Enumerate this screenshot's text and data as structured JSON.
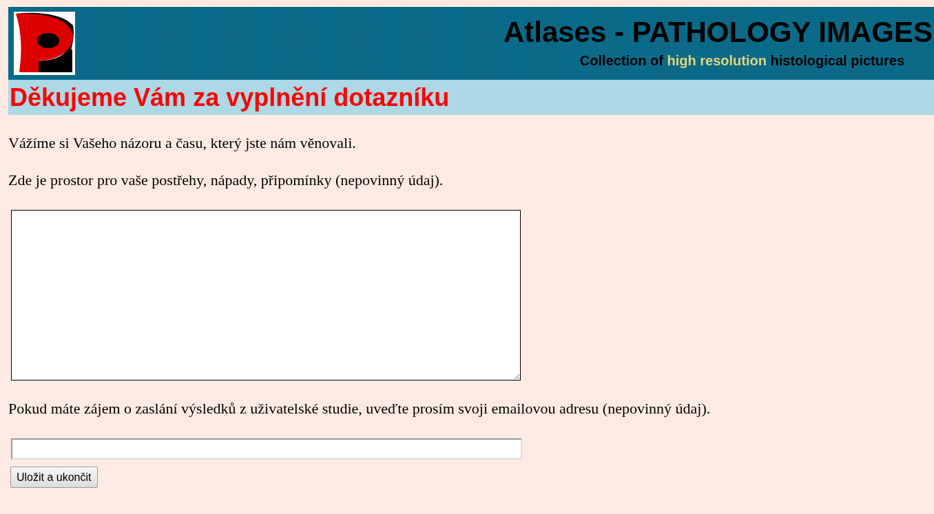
{
  "header": {
    "title": "Atlases - PATHOLOGY IMAGES",
    "subtitle": "Collection of **high resolution** histological pictures"
  },
  "heading": "Děkujeme Vám za vyplnění dotazníku",
  "paragraphs": [
    "Vážíme si Vašeho názoru a času, který jste nám věnovali.",
    "Zde je prostor pro vaše postřehy, nápady, připomínky (nepovinný údaj)."
  ],
  "email_prompt": "Pokud máte zájem o zaslání výsledků z uživatelské studie, uveďte prosím svoji emailovou adresu (nepovinný údaj).",
  "submit_button": "Uložit a ukončit"
}
